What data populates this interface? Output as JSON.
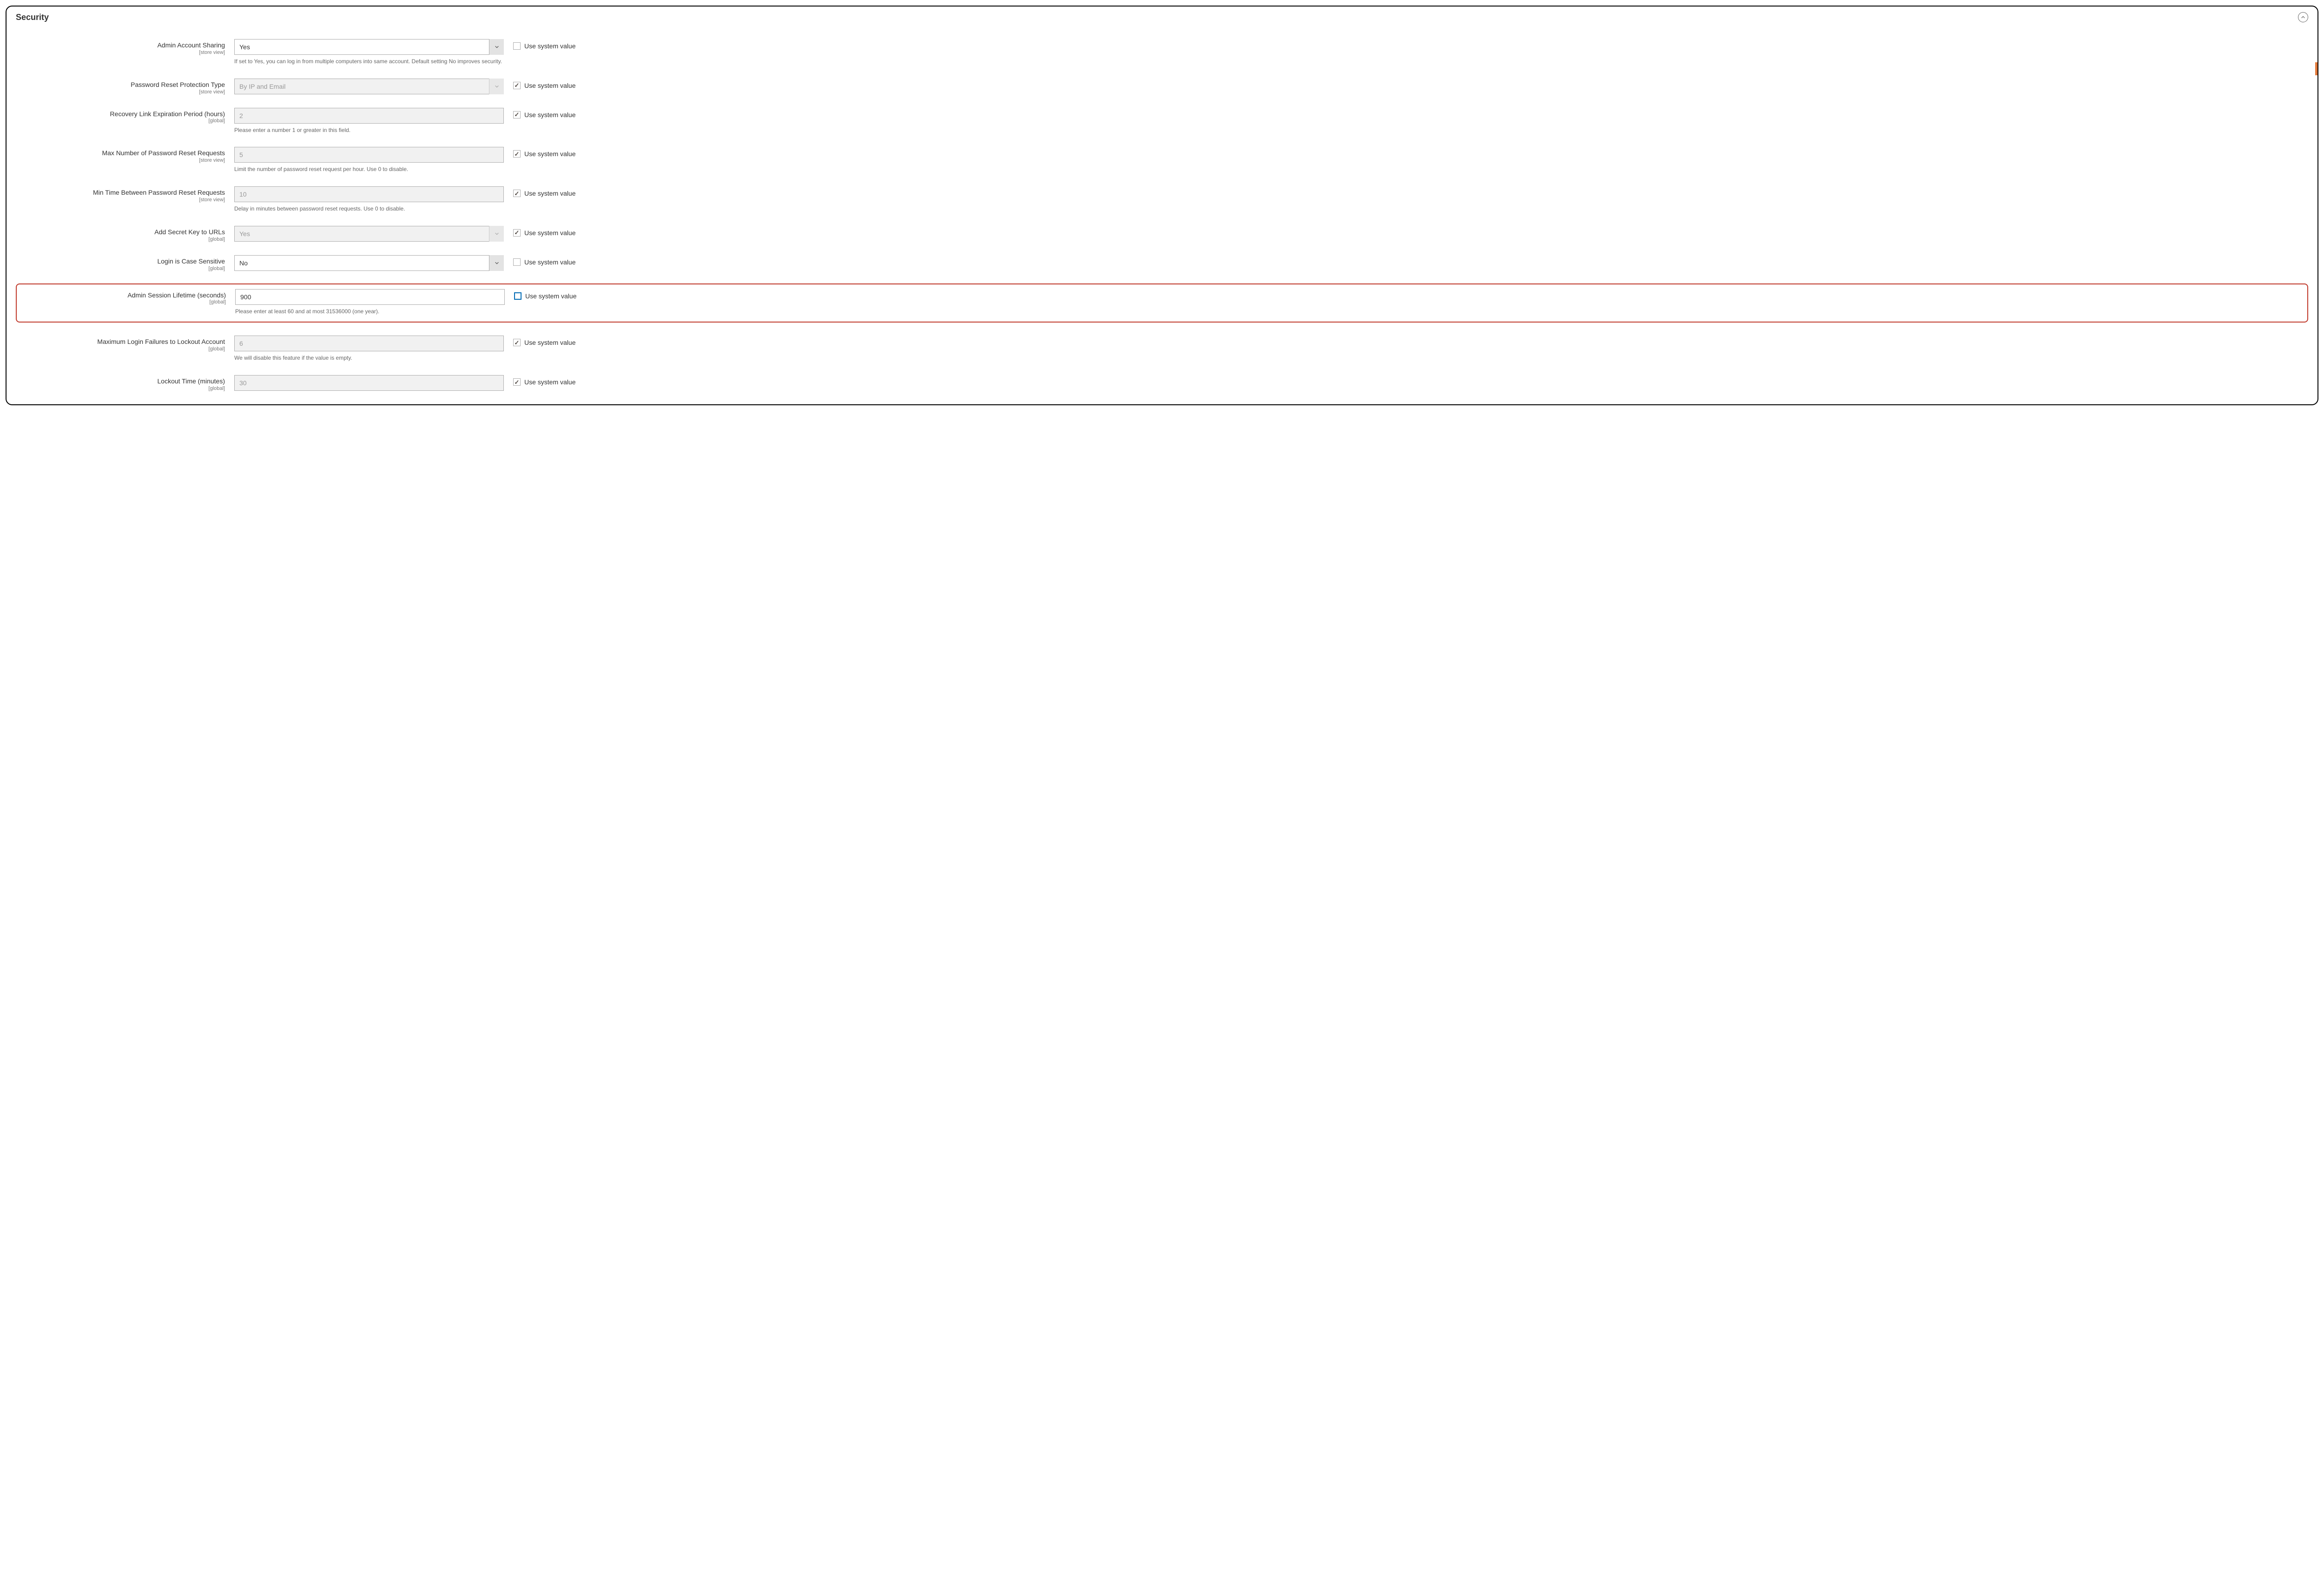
{
  "panel": {
    "title": "Security",
    "sys_label": "Use system value"
  },
  "rows": [
    {
      "id": "admin-account-sharing",
      "label": "Admin Account Sharing",
      "scope": "[store view]",
      "kind": "select",
      "value": "Yes",
      "disabled": false,
      "help": "If set to Yes, you can log in from multiple computers into same account. Default setting No improves security.",
      "sys_checked": false,
      "highlight": false,
      "chk_focus": false
    },
    {
      "id": "password-reset-protection-type",
      "label": "Password Reset Protection Type",
      "scope": "[store view]",
      "kind": "select",
      "value": "By IP and Email",
      "disabled": true,
      "help": "",
      "sys_checked": true,
      "highlight": false,
      "chk_focus": false
    },
    {
      "id": "recovery-link-expiration",
      "label": "Recovery Link Expiration Period (hours)",
      "scope": "[global]",
      "kind": "text",
      "value": "2",
      "disabled": true,
      "help": "Please enter a number 1 or greater in this field.",
      "sys_checked": true,
      "highlight": false,
      "chk_focus": false
    },
    {
      "id": "max-password-reset-requests",
      "label": "Max Number of Password Reset Requests",
      "scope": "[store view]",
      "kind": "text",
      "value": "5",
      "disabled": true,
      "help": "Limit the number of password reset request per hour. Use 0 to disable.",
      "sys_checked": true,
      "highlight": false,
      "chk_focus": false
    },
    {
      "id": "min-time-between-requests",
      "label": "Min Time Between Password Reset Requests",
      "scope": "[store view]",
      "kind": "text",
      "value": "10",
      "disabled": true,
      "help": "Delay in minutes between password reset requests. Use 0 to disable.",
      "sys_checked": true,
      "highlight": false,
      "chk_focus": false
    },
    {
      "id": "add-secret-key-to-urls",
      "label": "Add Secret Key to URLs",
      "scope": "[global]",
      "kind": "select",
      "value": "Yes",
      "disabled": true,
      "help": "",
      "sys_checked": true,
      "highlight": false,
      "chk_focus": false
    },
    {
      "id": "login-case-sensitive",
      "label": "Login is Case Sensitive",
      "scope": "[global]",
      "kind": "select",
      "value": "No",
      "disabled": false,
      "help": "",
      "sys_checked": false,
      "highlight": false,
      "chk_focus": false
    },
    {
      "id": "admin-session-lifetime",
      "label": "Admin Session Lifetime (seconds)",
      "scope": "[global]",
      "kind": "text",
      "value": "900",
      "disabled": false,
      "help": "Please enter at least 60 and at most 31536000 (one year).",
      "sys_checked": false,
      "highlight": true,
      "chk_focus": true
    },
    {
      "id": "max-login-failures",
      "label": "Maximum Login Failures to Lockout Account",
      "scope": "[global]",
      "kind": "text",
      "value": "6",
      "disabled": true,
      "help": "We will disable this feature if the value is empty.",
      "sys_checked": true,
      "highlight": false,
      "chk_focus": false
    },
    {
      "id": "lockout-time",
      "label": "Lockout Time (minutes)",
      "scope": "[global]",
      "kind": "text",
      "value": "30",
      "disabled": true,
      "help": "",
      "sys_checked": true,
      "highlight": false,
      "chk_focus": false
    }
  ]
}
